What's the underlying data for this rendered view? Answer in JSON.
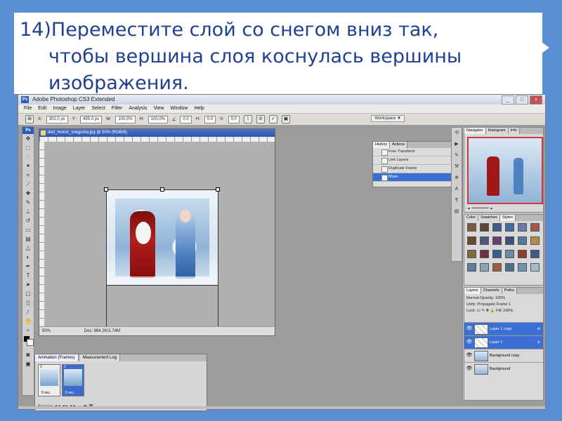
{
  "slide": {
    "instruction_lines": [
      "14)Переместите слой со снегом вниз так,",
      "чтобы вершина слоя коснулась вершины",
      "изображения."
    ]
  },
  "app": {
    "title": "Adobe Photoshop CS3 Extended",
    "logo": "Ps",
    "window_buttons": [
      "_",
      "□",
      "×"
    ]
  },
  "menu": [
    "File",
    "Edit",
    "Image",
    "Layer",
    "Select",
    "Filter",
    "Analysis",
    "View",
    "Window",
    "Help"
  ],
  "options_bar": {
    "x_label": "X:",
    "x_value": "302.0 px",
    "y_label": "Y:",
    "y_value": "495.0 px",
    "w_label": "W:",
    "w_value": "100.0%",
    "h_label": "H:",
    "h_value": "100.0%",
    "angle_value": "0.0",
    "h_skew_label": "H:",
    "h_skew_value": "0.0",
    "v_skew_label": "V:",
    "v_skew_value": "0.0",
    "workspace": "Workspace ▼"
  },
  "document": {
    "title": "ded_moroz_snegurka.jpg @ 50% (RGB/8)",
    "zoom": "50%",
    "doc_size": "Doc: 884.2K/1.74M"
  },
  "animation_panel": {
    "tabs": [
      "Animation (Frames)",
      "Measurement Log"
    ],
    "frames": [
      {
        "number": "1",
        "delay": "0 sec."
      },
      {
        "number": "2",
        "delay": "0 sec."
      }
    ],
    "loop": "Forever"
  },
  "history_panel": {
    "tabs": [
      "History",
      "Actions"
    ],
    "items": [
      "Free Transform",
      "Link Layers",
      "Duplicate Frame",
      "Move"
    ],
    "selected_index": 3
  },
  "navigator_panel": {
    "tabs": [
      "Navigator",
      "Histogram",
      "Info"
    ]
  },
  "swatches_panel": {
    "tabs": [
      "Color",
      "Swatches",
      "Styles"
    ],
    "colors": [
      "#7c5a3c",
      "#5d4636",
      "#3e5a8c",
      "#3f6e9d",
      "#6b7aa8",
      "#a65a4f",
      "#6a4a2e",
      "#4e5b7b",
      "#6a3f6d",
      "#3f4d7b",
      "#54799a",
      "#b58b4c",
      "#7e6b3d",
      "#6f2f47",
      "#3b5d8d",
      "#6a8aa2",
      "#8c3d33",
      "#445a85",
      "#5c7f99",
      "#8aa3b8",
      "#9d5b46",
      "#4e6e8e",
      "#7094b0",
      "#a8b9c7"
    ]
  },
  "layers_panel": {
    "tabs": [
      "Layers",
      "Channels",
      "Paths"
    ],
    "blend_mode": "Normal",
    "opacity": "Opacity: 100%",
    "unify": "Unify:",
    "propagate": "Propagate Frame 1",
    "lock": "Lock:",
    "fill": "Fill: 100%",
    "layers": [
      {
        "name": "Layer 1 copy",
        "selected": true,
        "thumb": "blank"
      },
      {
        "name": "Layer 1",
        "selected": true,
        "thumb": "blank"
      },
      {
        "name": "Background copy",
        "selected": false,
        "thumb": "image"
      },
      {
        "name": "Background",
        "selected": false,
        "thumb": "image"
      }
    ]
  }
}
